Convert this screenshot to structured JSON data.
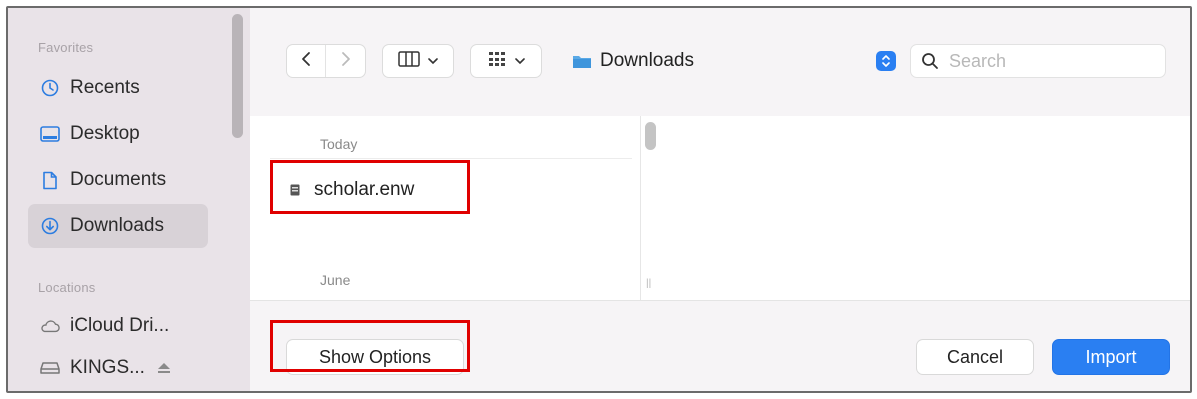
{
  "sidebar": {
    "favorites_heading": "Favorites",
    "locations_heading": "Locations",
    "items": [
      {
        "label": "Recents",
        "icon": "clock-icon"
      },
      {
        "label": "Desktop",
        "icon": "desktop-icon"
      },
      {
        "label": "Documents",
        "icon": "document-icon"
      },
      {
        "label": "Downloads",
        "icon": "download-icon",
        "selected": true
      }
    ],
    "locations": [
      {
        "label": "iCloud Dri...",
        "icon": "cloud-icon"
      },
      {
        "label": "KINGS...",
        "icon": "drive-icon",
        "eject_icon": "eject-icon"
      }
    ]
  },
  "toolbar": {
    "back_icon": "chevron-left-icon",
    "forward_icon": "chevron-right-icon",
    "view_mode_icon": "columns-view-icon",
    "group_icon": "grid-group-icon",
    "location": "Downloads",
    "search_placeholder": "Search"
  },
  "file_list": {
    "groups": [
      {
        "label": "Today",
        "files": [
          {
            "name": "scholar.enw",
            "icon": "file-icon"
          }
        ]
      },
      {
        "label": "June",
        "files": []
      }
    ]
  },
  "footer": {
    "show_options": "Show Options",
    "cancel": "Cancel",
    "import": "Import"
  },
  "colors": {
    "sidebar_bg": "#e9e3e8",
    "accent": "#2a7ff2",
    "highlight": "#e00000"
  }
}
